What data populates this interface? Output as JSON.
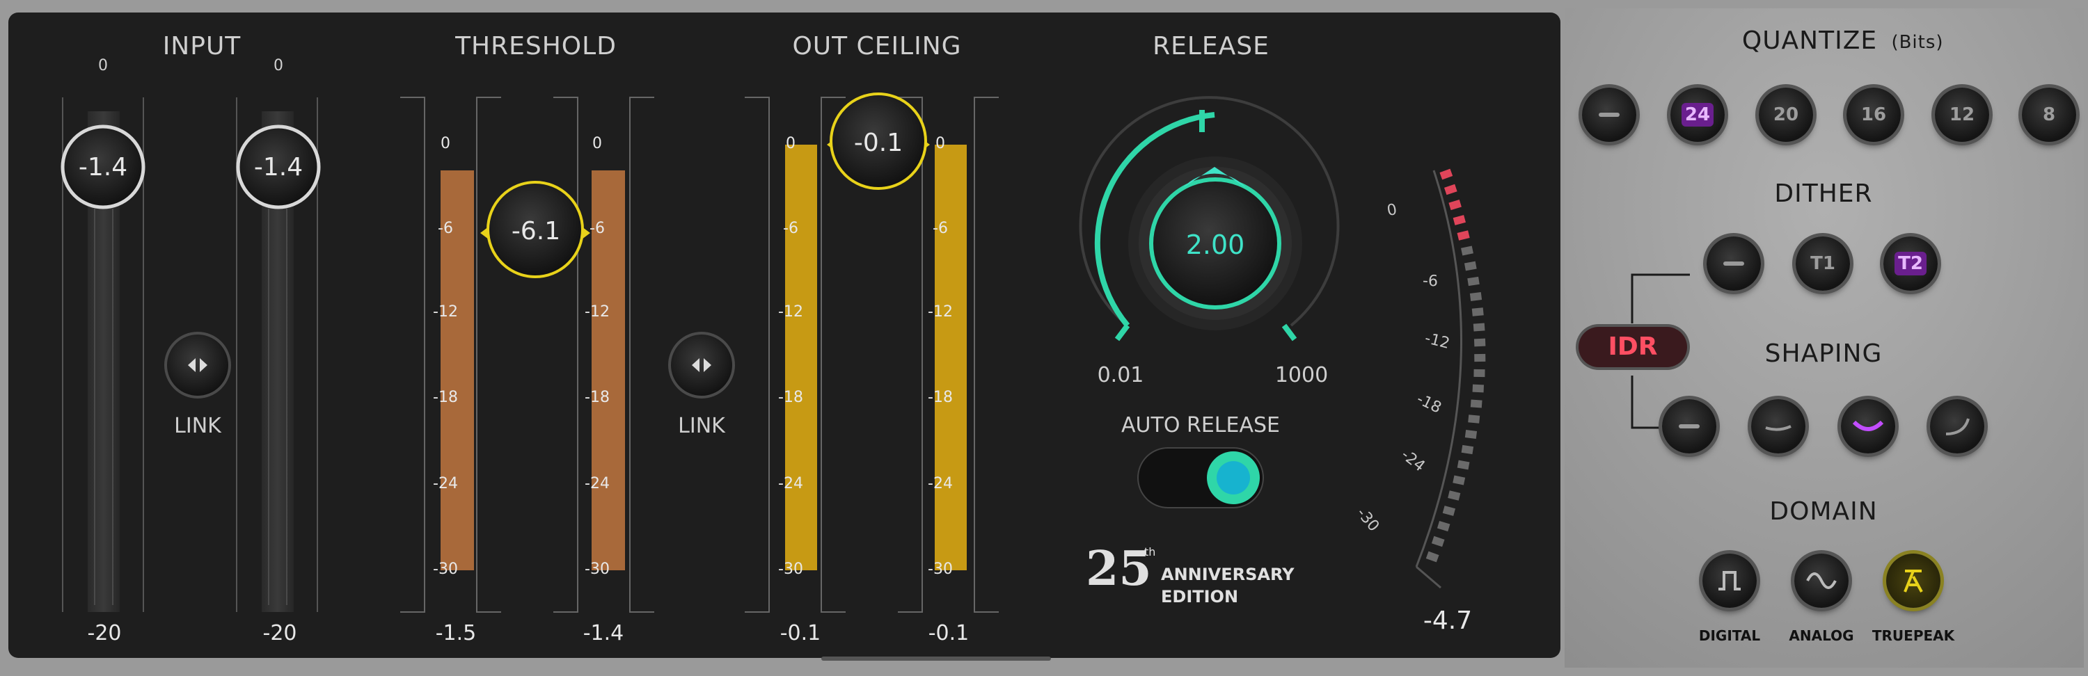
{
  "input": {
    "title": "INPUT",
    "left": {
      "value": "-1.4",
      "top_mark": "0",
      "bottom": "-20"
    },
    "right": {
      "value": "-1.4",
      "top_mark": "0",
      "bottom": "-20"
    },
    "link_label": "LINK"
  },
  "threshold": {
    "title": "THRESHOLD",
    "value": "-6.1",
    "left_bottom": "-1.5",
    "right_bottom": "-1.4",
    "scale": [
      "0",
      "-6",
      "-12",
      "-18",
      "-24",
      "-30"
    ]
  },
  "out_ceiling": {
    "title": "OUT CEILING",
    "value": "-0.1",
    "left_bottom": "-0.1",
    "right_bottom": "-0.1",
    "link_label": "LINK",
    "scale": [
      "0",
      "-6",
      "-12",
      "-18",
      "-24",
      "-30"
    ]
  },
  "release": {
    "title": "RELEASE",
    "value": "2.00",
    "min": "0.01",
    "max": "1000",
    "auto_release_label": "AUTO RELEASE",
    "auto_release_on": true
  },
  "anniversary": {
    "number": "25",
    "suffix": "th",
    "line1": "ANNIVERSARY",
    "line2": "EDITION"
  },
  "atten_meter": {
    "scale": [
      "0",
      "-6",
      "-12",
      "-18",
      "-24",
      "-30"
    ],
    "readout": "-4.7"
  },
  "quantize": {
    "title": "QUANTIZE",
    "subtitle": "(Bits)",
    "options": [
      "—",
      "24",
      "20",
      "16",
      "12",
      "8"
    ],
    "selected": "24"
  },
  "dither": {
    "title": "DITHER",
    "options": [
      "—",
      "T1",
      "T2"
    ],
    "selected": "T2"
  },
  "idr_label": "IDR",
  "shaping": {
    "title": "SHAPING",
    "options": [
      "none",
      "low",
      "medium",
      "high"
    ],
    "selected": "medium"
  },
  "domain": {
    "title": "DOMAIN",
    "options": [
      {
        "label": "DIGITAL",
        "icon": "square-wave-icon"
      },
      {
        "label": "ANALOG",
        "icon": "sine-wave-icon"
      },
      {
        "label": "TRUEPEAK",
        "icon": "truepeak-icon"
      }
    ],
    "selected": "TRUEPEAK"
  },
  "colors": {
    "panel": "#1e1e1e",
    "side": "#9a9a9a",
    "threshold_bar": "#a8693a",
    "ceiling_bar": "#c79a14",
    "teal": "#2fd6a8",
    "yellow": "#e8d21a",
    "purple": "#b048e6",
    "red": "#e0455a"
  }
}
